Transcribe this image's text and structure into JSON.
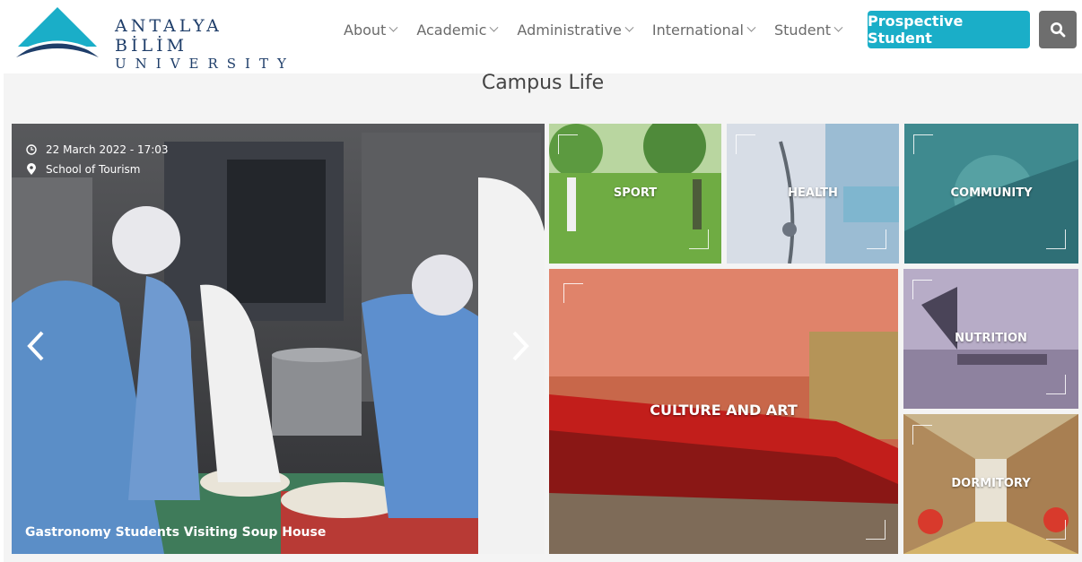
{
  "logo": {
    "line1": "ANTALYA BİLİM",
    "line2": "UNIVERSITY"
  },
  "nav": {
    "items": [
      {
        "label": "About"
      },
      {
        "label": "Academic"
      },
      {
        "label": "Administrative"
      },
      {
        "label": "International"
      },
      {
        "label": "Student"
      }
    ],
    "cta_label": "Prospective Student"
  },
  "section": {
    "title": "Campus Life"
  },
  "slider": {
    "date": "22 March 2022 - 17:03",
    "location": "School of Tourism",
    "caption": "Gastronomy Students Visiting Soup House"
  },
  "tiles": {
    "sport": "SPORT",
    "health": "HEALTH",
    "community": "COMMUNITY",
    "culture": "CULTURE AND ART",
    "nutrition": "NUTRITION",
    "dormitory": "DORMITORY"
  },
  "colors": {
    "accent": "#1aaec8",
    "search_bg": "#6e6e6e",
    "brand": "#1f3e6a"
  }
}
